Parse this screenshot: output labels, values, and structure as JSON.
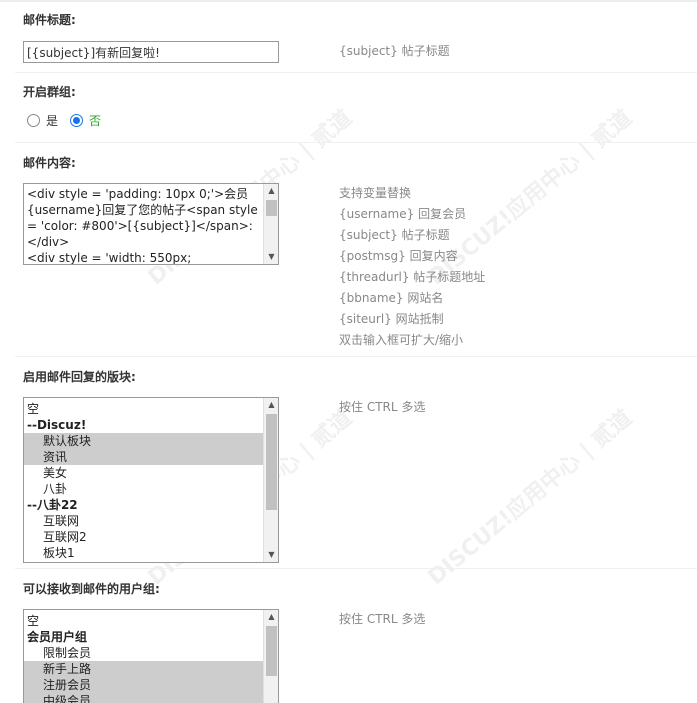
{
  "subject": {
    "label": "邮件标题:",
    "value": "[{subject}]有新回复啦!",
    "tip_var": "{subject}",
    "tip_text": " 帖子标题"
  },
  "group": {
    "label": "开启群组:",
    "options": [
      "是",
      "否"
    ],
    "selected": "否"
  },
  "content": {
    "label": "邮件内容:",
    "value": "<div style = 'padding: 10px 0;'>会员{username}回复了您的帖子<span style = 'color: #800'>[{subject}]</span>:</div>\n<div style = 'width: 550px;",
    "tips": [
      {
        "var": "",
        "text": "支持变量替换"
      },
      {
        "var": "{username}",
        "text": " 回复会员"
      },
      {
        "var": "{subject}",
        "text": " 帖子标题"
      },
      {
        "var": "{postmsg}",
        "text": " 回复内容"
      },
      {
        "var": "{threadurl}",
        "text": " 帖子标题地址"
      },
      {
        "var": "{bbname}",
        "text": " 网站名"
      },
      {
        "var": "{siteurl}",
        "text": " 网站抵制"
      },
      {
        "var": "",
        "text": "双击输入框可扩大/缩小"
      }
    ]
  },
  "forums": {
    "label": "启用邮件回复的版块:",
    "tip": "按住 CTRL 多选",
    "options": [
      {
        "text": "空",
        "type": "plain",
        "selected": false
      },
      {
        "text": "--Discuz!",
        "type": "group",
        "selected": false
      },
      {
        "text": "默认板块",
        "type": "child",
        "selected": true
      },
      {
        "text": "资讯",
        "type": "child",
        "selected": true
      },
      {
        "text": "美女",
        "type": "child",
        "selected": false
      },
      {
        "text": "八卦",
        "type": "child",
        "selected": false
      },
      {
        "text": "--八卦22",
        "type": "group",
        "selected": false
      },
      {
        "text": "互联网",
        "type": "child",
        "selected": false
      },
      {
        "text": "互联网2",
        "type": "child",
        "selected": false
      },
      {
        "text": "板块1",
        "type": "child",
        "selected": false
      }
    ]
  },
  "usergroups": {
    "label": "可以接收到邮件的用户组:",
    "tip": "按住 CTRL 多选",
    "options": [
      {
        "text": "空",
        "type": "plain",
        "selected": false
      },
      {
        "text": "会员用户组",
        "type": "group",
        "selected": false
      },
      {
        "text": "限制会员",
        "type": "child",
        "selected": false
      },
      {
        "text": "新手上路",
        "type": "child",
        "selected": true
      },
      {
        "text": "注册会员",
        "type": "child",
        "selected": true
      },
      {
        "text": "中级会员",
        "type": "child",
        "selected": true
      }
    ]
  },
  "watermark": {
    "brand": "DISCUZ!应用中心 | 贰道",
    "url": "addon.dismall.com"
  },
  "colors": {
    "tip": "#888888",
    "selected_option": "#cdcdcd",
    "radio_accent": "#1a73e8",
    "no_label": "#2aa52a"
  }
}
